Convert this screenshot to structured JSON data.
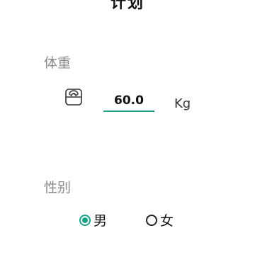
{
  "header": {
    "title": "计划"
  },
  "weight": {
    "label": "体重",
    "value": "60.0",
    "unit": "Kg",
    "icon": "scale-icon"
  },
  "gender": {
    "label": "性别",
    "options": [
      {
        "label": "男",
        "selected": true
      },
      {
        "label": "女",
        "selected": false
      }
    ]
  },
  "colors": {
    "accent": "#1aa38a",
    "label_gray": "#8a8a8a"
  }
}
